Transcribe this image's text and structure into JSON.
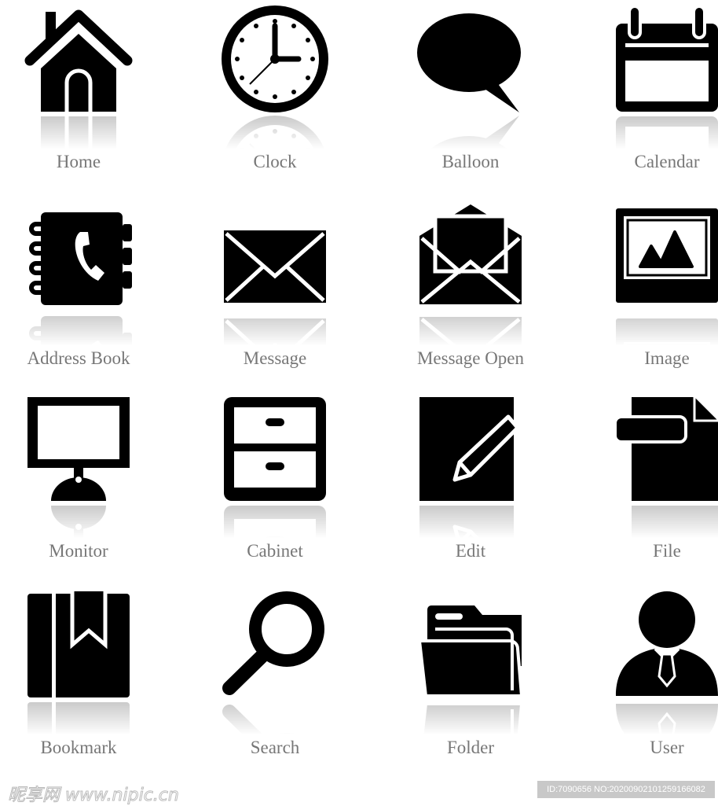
{
  "icons": [
    {
      "label": "Home",
      "icon": "home-icon"
    },
    {
      "label": "Clock",
      "icon": "clock-icon"
    },
    {
      "label": "Balloon",
      "icon": "speech-balloon-icon"
    },
    {
      "label": "Calendar",
      "icon": "calendar-icon"
    },
    {
      "label": "Address Book",
      "icon": "address-book-icon"
    },
    {
      "label": "Message",
      "icon": "envelope-icon"
    },
    {
      "label": "Message Open",
      "icon": "envelope-open-icon"
    },
    {
      "label": "Image",
      "icon": "image-icon"
    },
    {
      "label": "Monitor",
      "icon": "monitor-icon"
    },
    {
      "label": "Cabinet",
      "icon": "cabinet-icon"
    },
    {
      "label": "Edit",
      "icon": "edit-pencil-icon"
    },
    {
      "label": "File",
      "icon": "file-icon"
    },
    {
      "label": "Bookmark",
      "icon": "bookmark-icon"
    },
    {
      "label": "Search",
      "icon": "search-magnifier-icon"
    },
    {
      "label": "Folder",
      "icon": "folder-icon"
    },
    {
      "label": "User",
      "icon": "user-icon"
    }
  ],
  "watermark": {
    "logo": "昵享网 www.nipic.cn",
    "id": "ID:7090656 NO:20200902101259166082"
  }
}
